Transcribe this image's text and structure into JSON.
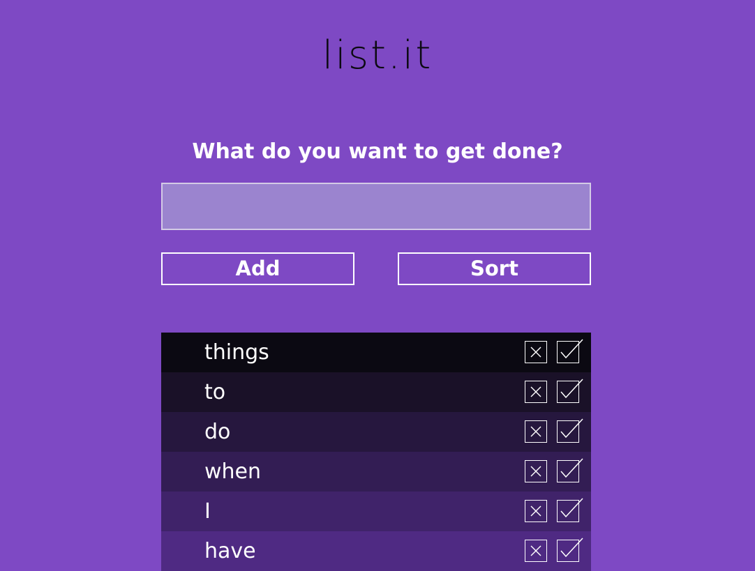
{
  "app": {
    "logo": "list.it",
    "prompt": "What do you want to get done?"
  },
  "input": {
    "value": "",
    "placeholder": ""
  },
  "buttons": {
    "add_label": "Add",
    "sort_label": "Sort"
  },
  "colors": {
    "background": "#7e49c4",
    "input_bg": "#9b84cf",
    "logo_text": "#0c0a12"
  },
  "todos": [
    {
      "text": "things",
      "bg": "#0b0912"
    },
    {
      "text": "to",
      "bg": "#1a1128"
    },
    {
      "text": "do",
      "bg": "#26173e"
    },
    {
      "text": "when",
      "bg": "#331d54"
    },
    {
      "text": "I",
      "bg": "#40236a"
    },
    {
      "text": "have",
      "bg": "#4f2a83"
    }
  ],
  "icons": {
    "remove": "close-icon",
    "done": "checkmark-icon"
  }
}
